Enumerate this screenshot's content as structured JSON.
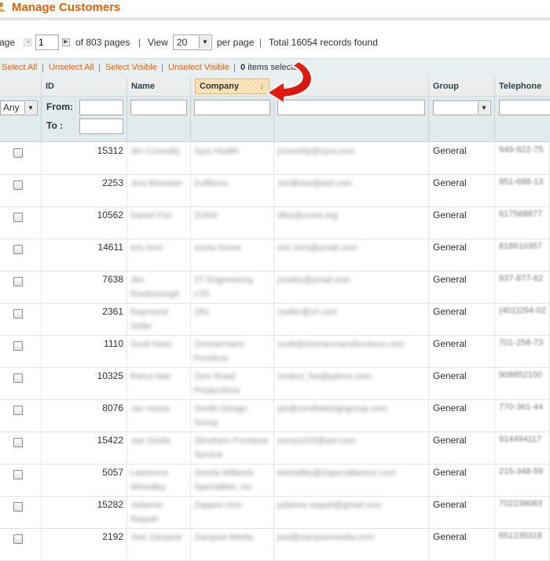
{
  "header": {
    "title": "Manage Customers"
  },
  "pager": {
    "page_label": "age",
    "page_value": "1",
    "of_pages": "of 803 pages",
    "view_label": "View",
    "per_page_value": "20",
    "per_page_label": "per page",
    "total": "Total 16054 records found"
  },
  "massaction": {
    "select_all": "Select All",
    "unselect_all": "Unselect All",
    "select_visible": "Select Visible",
    "unselect_visible": "Unselect Visible",
    "count_num": "0",
    "count_text": "items selecte"
  },
  "columns": {
    "id": "ID",
    "name": "Name",
    "company": "Company",
    "group": "Group",
    "telephone": "Telephone",
    "sort_indicator": "↓"
  },
  "filters": {
    "any": "Any",
    "from": "From:",
    "to": "To :"
  },
  "rows": [
    {
      "id": "15312",
      "name": "Jim Connolly",
      "company": "Zyra Health",
      "email": "jconnolly@zyra.com",
      "group": "General",
      "tel": "949-922-75"
    },
    {
      "id": "2253",
      "name": "Joni Brewster",
      "company": "Zulflorna",
      "email": "JoniBrew@aol.com",
      "group": "General",
      "tel": "951-698-13"
    },
    {
      "id": "10562",
      "name": "Daniel Fox",
      "company": "ZUMII",
      "email": "dfox@zumii.org",
      "group": "General",
      "tel": "617568877"
    },
    {
      "id": "14611",
      "name": "eric lomi",
      "company": "zuma house",
      "email": "eric.lomi@ymail.com",
      "group": "General",
      "tel": "818610357"
    },
    {
      "id": "7638",
      "name": "Jim Rowborough",
      "company": "ZT Engineering LTD",
      "email": "jrowbo@ymail.com",
      "group": "General",
      "tel": "937-877-62"
    },
    {
      "id": "2361",
      "name": "Raymond Zeller",
      "company": "ZRL",
      "email": "rzeller@zrl.com",
      "group": "General",
      "tel": "(401)254-02"
    },
    {
      "id": "1110",
      "name": "Scott Klein",
      "company": "Zimmermans Furniture",
      "email": "scott@zimmermansfurniture.com",
      "group": "General",
      "tel": "701-258-73"
    },
    {
      "id": "10325",
      "name": "Rahul Nair",
      "company": "Zero Road Productions",
      "email": "mrahul_fse@yahoo.com",
      "group": "General",
      "tel": "908852100"
    },
    {
      "id": "8076",
      "name": "Jan reavis",
      "company": "Zenith Design Group",
      "email": "jan@zenithdesigngroup.com",
      "group": "General",
      "tel": "770-361-44"
    },
    {
      "id": "15422",
      "name": "Joe Zeolla",
      "company": "Zbrothers Furniture Service",
      "email": "joezy1025@aol.com",
      "group": "General",
      "tel": "914494117"
    },
    {
      "id": "5057",
      "name": "Lawrence Whealley",
      "company": "Zavela Millwork Specialties, Inc",
      "email": "lwhealley@zspecialtiesinc.com",
      "group": "General",
      "tel": "215-348-59"
    },
    {
      "id": "15282",
      "name": "Julianne Raquel",
      "company": "Zappos.com",
      "email": "julianne.raquel@gmail.com",
      "group": "General",
      "tel": "702239083"
    },
    {
      "id": "2192",
      "name": "Joel Zampow",
      "company": "Zampow Media",
      "email": "joel@zampowmedia.com",
      "group": "General",
      "tel": "651235318"
    }
  ]
}
